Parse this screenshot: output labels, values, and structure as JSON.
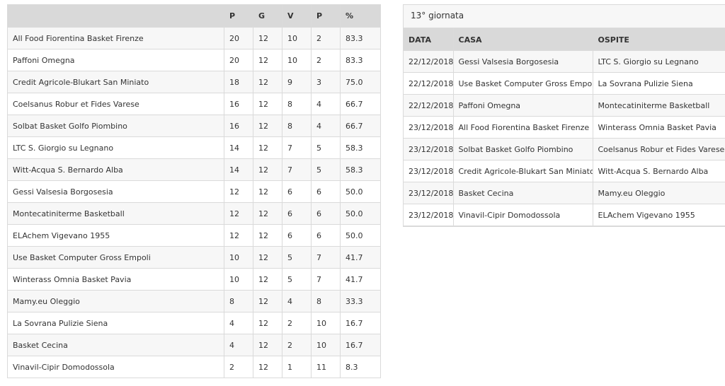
{
  "standings": {
    "headers": [
      "",
      "P",
      "G",
      "V",
      "P",
      "%"
    ],
    "rows": [
      [
        "All Food Fiorentina Basket Firenze",
        "20",
        "12",
        "10",
        "2",
        "83.3"
      ],
      [
        "Paffoni Omegna",
        "20",
        "12",
        "10",
        "2",
        "83.3"
      ],
      [
        "Credit Agricole-Blukart San Miniato",
        "18",
        "12",
        "9",
        "3",
        "75.0"
      ],
      [
        "Coelsanus Robur et Fides Varese",
        "16",
        "12",
        "8",
        "4",
        "66.7"
      ],
      [
        "Solbat Basket Golfo Piombino",
        "16",
        "12",
        "8",
        "4",
        "66.7"
      ],
      [
        "LTC S. Giorgio su Legnano",
        "14",
        "12",
        "7",
        "5",
        "58.3"
      ],
      [
        "Witt-Acqua S. Bernardo Alba",
        "14",
        "12",
        "7",
        "5",
        "58.3"
      ],
      [
        "Gessi Valsesia Borgosesia",
        "12",
        "12",
        "6",
        "6",
        "50.0"
      ],
      [
        "Montecatiniterme Basketball",
        "12",
        "12",
        "6",
        "6",
        "50.0"
      ],
      [
        "ELAchem Vigevano 1955",
        "12",
        "12",
        "6",
        "6",
        "50.0"
      ],
      [
        "Use Basket Computer Gross Empoli",
        "10",
        "12",
        "5",
        "7",
        "41.7"
      ],
      [
        "Winterass Omnia Basket Pavia",
        "10",
        "12",
        "5",
        "7",
        "41.7"
      ],
      [
        "Mamy.eu Oleggio",
        "8",
        "12",
        "4",
        "8",
        "33.3"
      ],
      [
        "La Sovrana Pulizie Siena",
        "4",
        "12",
        "2",
        "10",
        "16.7"
      ],
      [
        "Basket Cecina",
        "4",
        "12",
        "2",
        "10",
        "16.7"
      ],
      [
        "Vinavil-Cipir Domodossola",
        "2",
        "12",
        "1",
        "11",
        "8.3"
      ]
    ]
  },
  "round": {
    "title": "13° giornata",
    "headers": [
      "DATA",
      "CASA",
      "OSPITE"
    ],
    "rows": [
      [
        "22/12/2018",
        "Gessi Valsesia Borgosesia",
        "LTC S. Giorgio su Legnano"
      ],
      [
        "22/12/2018",
        "Use Basket Computer Gross Empoli",
        "La Sovrana Pulizie Siena"
      ],
      [
        "22/12/2018",
        "Paffoni Omegna",
        "Montecatiniterme Basketball"
      ],
      [
        "23/12/2018",
        "All Food Fiorentina Basket Firenze",
        "Winterass Omnia Basket Pavia"
      ],
      [
        "23/12/2018",
        "Solbat Basket Golfo Piombino",
        "Coelsanus Robur et Fides Varese"
      ],
      [
        "23/12/2018",
        "Credit Agricole-Blukart San Miniato",
        "Witt-Acqua S. Bernardo Alba"
      ],
      [
        "23/12/2018",
        "Basket Cecina",
        "Mamy.eu Oleggio"
      ],
      [
        "23/12/2018",
        "Vinavil-Cipir Domodossola",
        "ELAchem Vigevano 1955"
      ]
    ]
  }
}
